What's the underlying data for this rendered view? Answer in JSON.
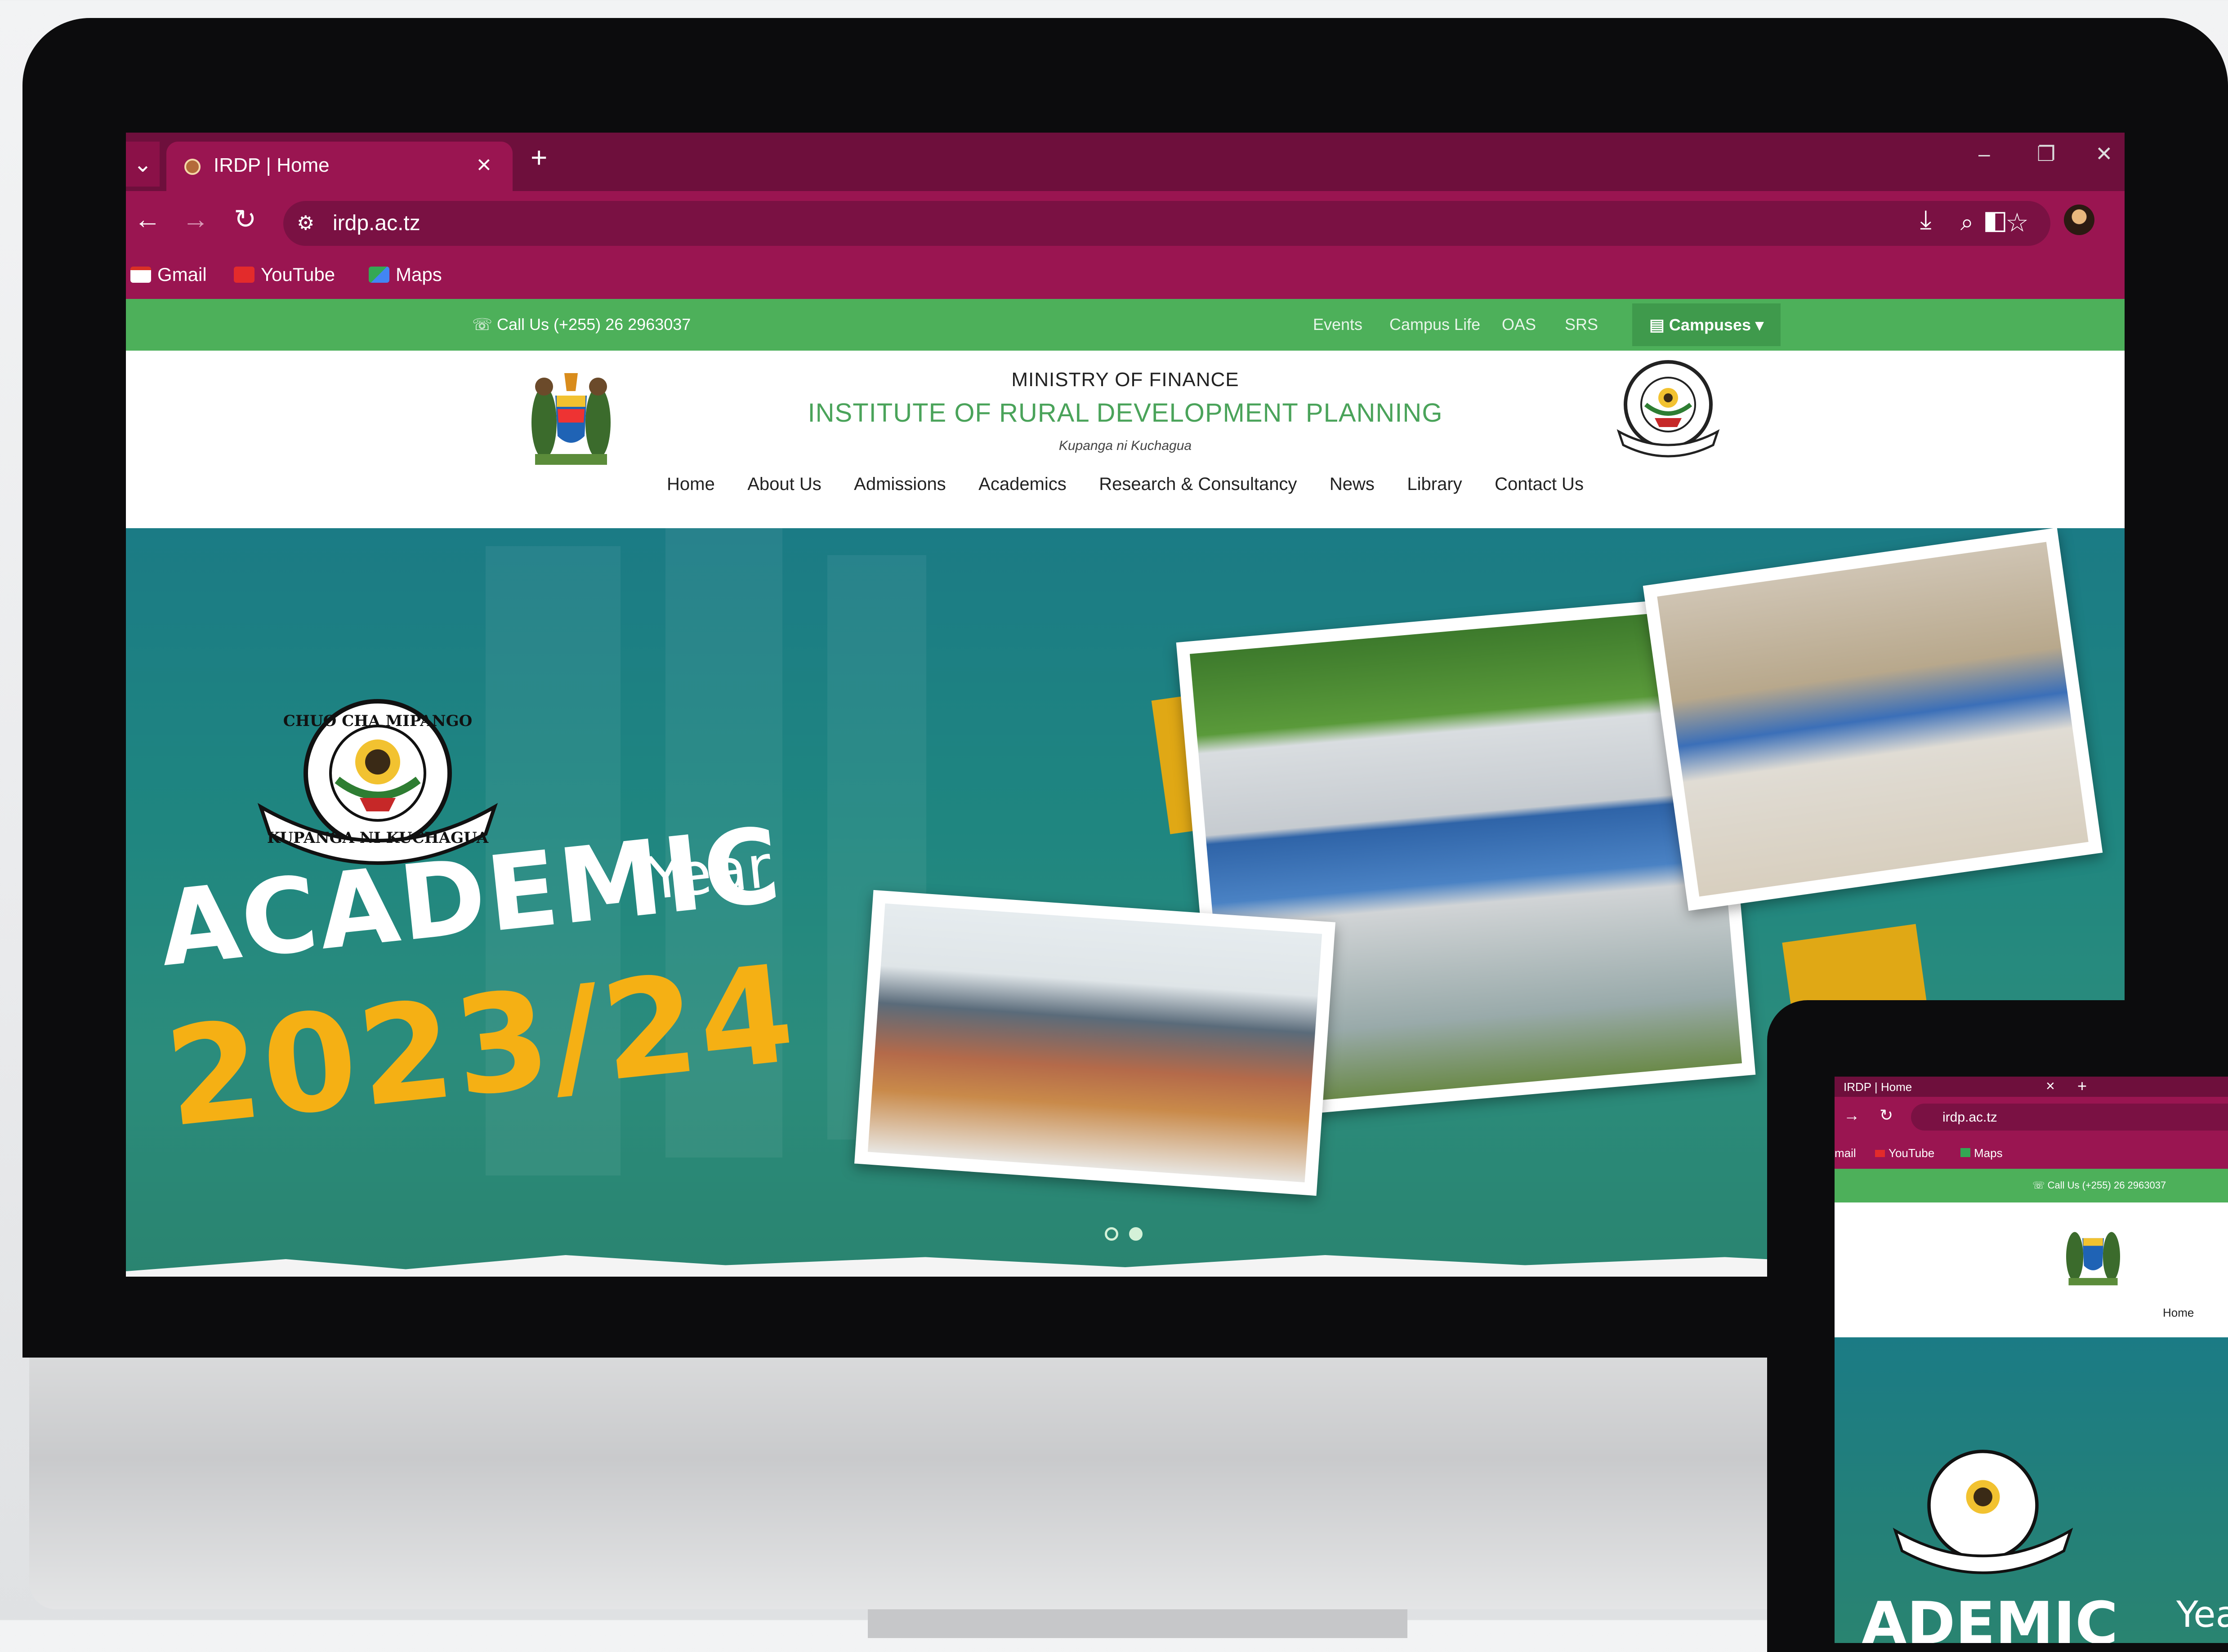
{
  "browser": {
    "tab_title": "IRDP | Home",
    "url": "irdp.ac.tz",
    "bookmarks": [
      {
        "label": "Gmail",
        "icon": "gmail-icon"
      },
      {
        "label": "YouTube",
        "icon": "youtube-icon"
      },
      {
        "label": "Maps",
        "icon": "maps-icon"
      }
    ],
    "colors": {
      "tab_strip": "#6e0f3c",
      "toolbar": "#9a1551"
    }
  },
  "site": {
    "topbar": {
      "call": "Call Us (+255) 26 2963037",
      "links": [
        "Events",
        "Campus Life",
        "OAS",
        "SRS"
      ],
      "campuses": "Campuses",
      "color": "#4db05a"
    },
    "header": {
      "ministry": "MINISTRY OF FINANCE",
      "institute": "INSTITUTE OF RURAL DEVELOPMENT PLANNING",
      "motto": "Kupanga ni Kuchagua"
    },
    "nav": [
      "Home",
      "About Us",
      "Admissions",
      "Academics",
      "Research & Consultancy",
      "News",
      "Library",
      "Contact Us"
    ],
    "hero": {
      "academic": "ACADEMIC",
      "year_word": "Year",
      "year": "2023/24",
      "badge_top": "CHUO CHA MIPANGO",
      "badge_bottom": "KUPANGA NI KUCHAGUA",
      "accent": "#f5b014"
    }
  },
  "tablet": {
    "tab_title": "IRDP | Home",
    "url": "irdp.ac.tz",
    "bookmarks": [
      "mail",
      "YouTube",
      "Maps"
    ],
    "call": "Call Us (+255) 26 2963037",
    "nav_home": "Home",
    "hero_text": "ADEMIC",
    "hero_year_fragment": "Yea"
  }
}
